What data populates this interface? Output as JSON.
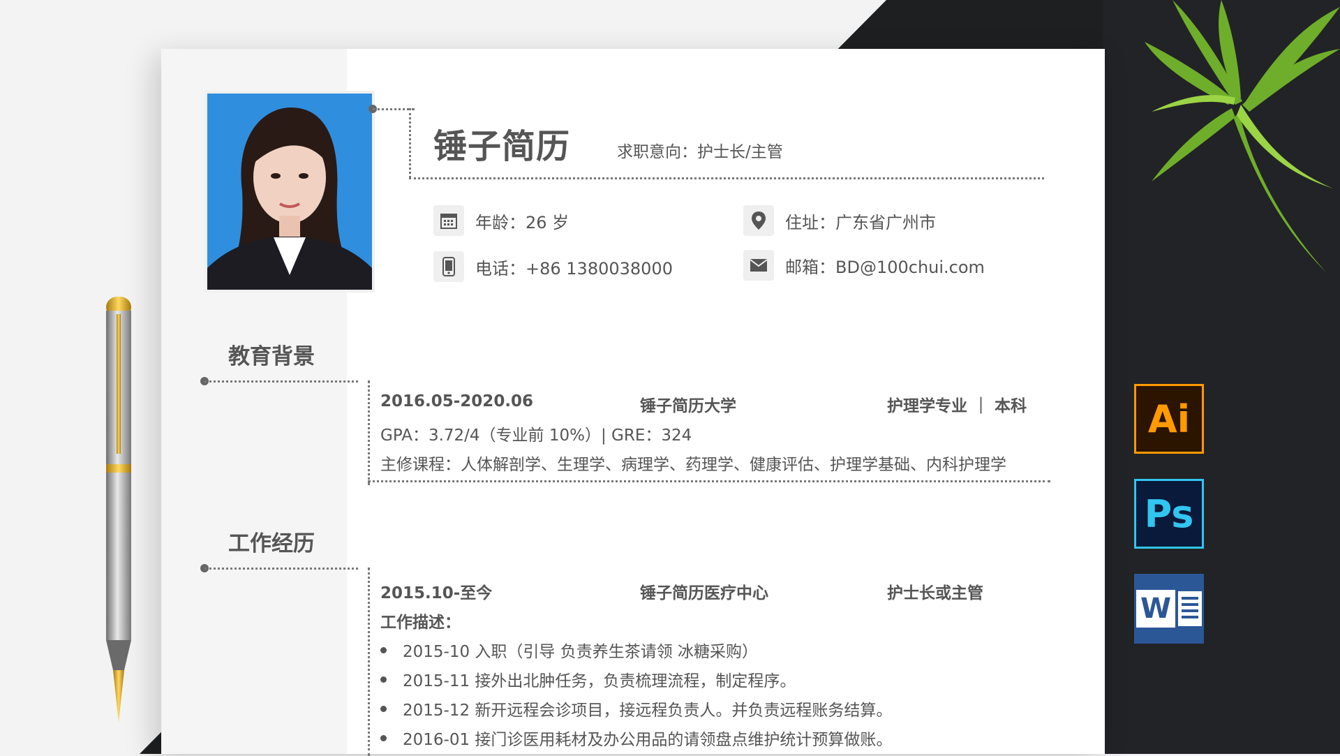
{
  "header": {
    "name": "锤子简历",
    "job_intent": "求职意向：护士长/主管"
  },
  "info": {
    "age": "年龄：26 岁",
    "address": "住址：广东省广州市",
    "phone": "电话：+86 1380038000",
    "email": "邮箱：BD@100chui.com"
  },
  "education": {
    "title": "教育背景",
    "period": "2016.05-2020.06",
    "school": "锤子简历大学",
    "major": "护理学专业 ｜ 本科",
    "gpa": "GPA：3.72/4（专业前 10%）| GRE：324",
    "courses": "主修课程：人体解剖学、生理学、病理学、药理学、健康评估、护理学基础、内科护理学"
  },
  "work": {
    "title": "工作经历",
    "period": "2015.10-至今",
    "company": "锤子简历医疗中心",
    "role": "护士长或主管",
    "desc_label": "工作描述：",
    "items": [
      "2015-10  入职（引导 负责养生茶请领  冰糖采购）",
      "2015-11  接外出北肿任务，负责梳理流程，制定程序。",
      "2015-12  新开远程会诊项目，接远程负责人。并负责远程账务结算。",
      "2016-01  接门诊医用耗材及办公用品的请领盘点维护统计预算做账。"
    ]
  },
  "apps": {
    "ai": "Ai",
    "ps": "Ps",
    "word": "W"
  },
  "colors": {
    "ai_bg": "#2b1400",
    "ai_fg": "#ff9a00",
    "ps_bg": "#0a1a3a",
    "ps_fg": "#31c5f0",
    "word_bg": "#2b5797",
    "photo_bg": "#2f8fde"
  }
}
